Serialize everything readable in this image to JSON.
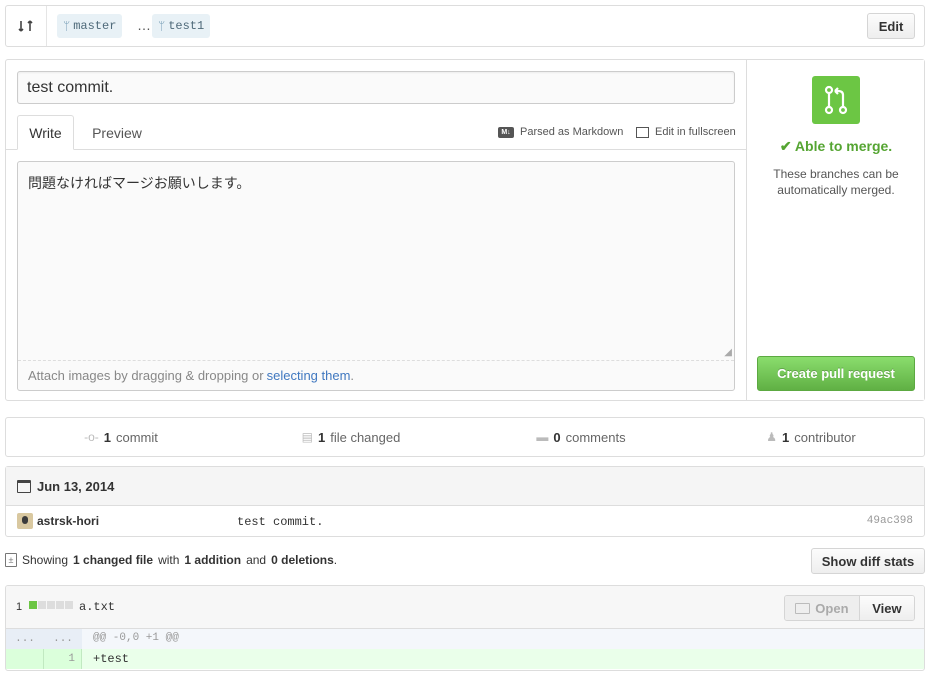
{
  "range": {
    "base_branch": "master",
    "separator": "…",
    "compare_branch": "test1",
    "edit_label": "Edit"
  },
  "compose": {
    "title_value": "test commit.",
    "tabs": [
      {
        "label": "Write",
        "active": true
      },
      {
        "label": "Preview",
        "active": false
      }
    ],
    "parsed_markdown_label": "Parsed as Markdown",
    "fullscreen_label": "Edit in fullscreen",
    "body_value": "問題なければマージお願いします。",
    "attach_prefix": "Attach images by dragging & dropping or",
    "attach_link": "selecting them",
    "attach_suffix": "."
  },
  "merge": {
    "status": "✔ Able to merge.",
    "description": "These branches can be automatically merged.",
    "create_button": "Create pull request",
    "status_color": "#55a532",
    "button_color": "#6cc644"
  },
  "stats": {
    "commits_count": "1",
    "commits_label": "commit",
    "files_count": "1",
    "files_label": "file changed",
    "comments_count": "0",
    "comments_label": "comments",
    "contributors_count": "1",
    "contributors_label": "contributor"
  },
  "commits": {
    "date": "Jun 13, 2014",
    "rows": [
      {
        "author": "astrsk-hori",
        "message": "test commit.",
        "sha": "49ac398"
      }
    ]
  },
  "summary": {
    "showing": "Showing",
    "changed": "1 changed file",
    "with": "with",
    "additions": "1 addition",
    "and": "and",
    "deletions": "0 deletions",
    "period": ".",
    "diff_stats_button": "Show diff stats"
  },
  "file": {
    "change_count": "1",
    "name": "a.txt",
    "open_label": "Open",
    "view_label": "View",
    "hunk_left": "...",
    "hunk_right": "...",
    "hunk_header": "@@ -0,0 +1 @@",
    "lines": [
      {
        "old": "",
        "new": "1",
        "text": "+test"
      }
    ]
  }
}
